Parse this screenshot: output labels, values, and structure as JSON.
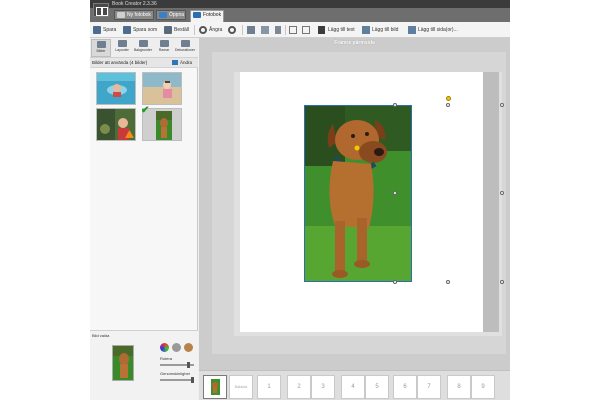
{
  "window": {
    "title": "Book Creator 2.3.36"
  },
  "topbar": {
    "new_book": "Ny fotobok",
    "open": "Öppna",
    "tab_photobook": "Fotobok"
  },
  "toolbar": {
    "save": "Spara",
    "save_as": "Spara som",
    "order": "Beställ",
    "undo": "Ångra",
    "add_text": "Lägg till text",
    "add_image": "Lägg till bild",
    "add_page": "Lägg till sida(or)..."
  },
  "left_panel": {
    "tabs": [
      "Bilder",
      "Layouter",
      "Bakgrunder",
      "Ramar",
      "Dekorationer"
    ],
    "images_header": "Bilder att använda (4 bilder)",
    "change": "Ändra",
    "selected_header": "Bild valda",
    "rotate_label": "Rotera",
    "transparency_label": "Genomskinlighet",
    "rotate_value": 0.82,
    "transparency_value": 0.95
  },
  "canvas": {
    "page_title": "Främre pärmsida"
  },
  "page_strip": {
    "front_label": "Framsida",
    "back_label": "Baksida",
    "pages": [
      "1",
      "2",
      "3",
      "4",
      "5",
      "6",
      "7",
      "8",
      "9"
    ]
  },
  "colors": {
    "accent": "#2c6fb0",
    "handle_rotate": "#f2c800",
    "warning": "#f08c1a",
    "check": "#1f9c1f"
  }
}
